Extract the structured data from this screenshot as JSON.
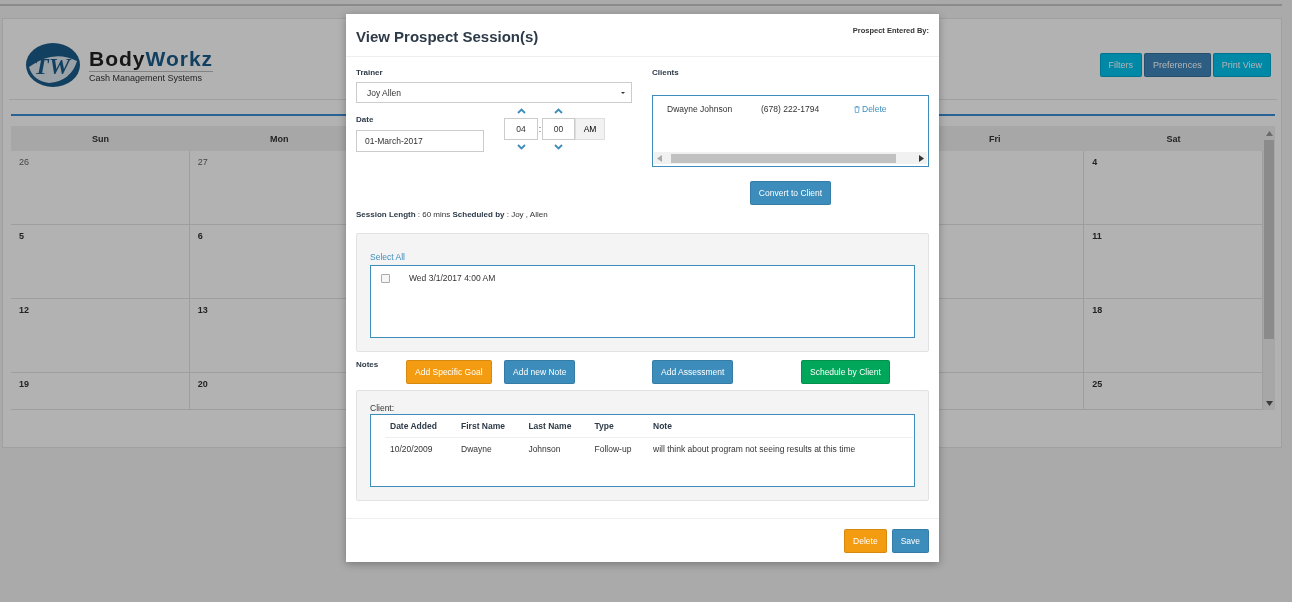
{
  "header": {
    "logo_mark": "TW",
    "brand_dark": "Body",
    "brand_blue": "Workz",
    "tagline": "Cash Management Systems"
  },
  "toolbar": [
    {
      "label": "Filters",
      "kind": "info"
    },
    {
      "label": "Preferences",
      "kind": "primary"
    },
    {
      "label": "Print View",
      "kind": "info"
    }
  ],
  "calendar": {
    "left_columns": [
      {
        "day": "Sun",
        "dates": [
          {
            "label": "26",
            "other_month": true
          },
          {
            "label": "5",
            "other_month": false
          },
          {
            "label": "12",
            "other_month": false
          },
          {
            "label": "19",
            "other_month": false
          }
        ]
      },
      {
        "day": "Mon",
        "dates": [
          {
            "label": "27",
            "other_month": true
          },
          {
            "label": "6",
            "other_month": false
          },
          {
            "label": "13",
            "other_month": false
          },
          {
            "label": "20",
            "other_month": false
          }
        ]
      }
    ],
    "right_columns": [
      {
        "day": "Fri"
      },
      {
        "day": "Sat",
        "dates": [
          {
            "label": "4",
            "other_month": false
          },
          {
            "label": "11",
            "other_month": false
          },
          {
            "label": "18",
            "other_month": false
          },
          {
            "label": "25",
            "other_month": false
          }
        ]
      }
    ]
  },
  "modal": {
    "title": "View Prospect Session(s)",
    "entered_by_label": "Prospect Entered By:",
    "trainer": {
      "label": "Trainer",
      "value": "Joy Allen"
    },
    "date": {
      "label": "Date",
      "value": "01-March-2017",
      "hour": "04",
      "separator": ":",
      "minute": "00",
      "meridiem": "AM"
    },
    "clients": {
      "label": "Clients",
      "rows": [
        {
          "name": "Dwayne Johnson",
          "phone": "(678) 222-1794",
          "action": "Delete"
        }
      ],
      "convert_button": "Convert to Client"
    },
    "session_info": "**Session Length** : 60 mins **Scheduled by** : Joy , Allen",
    "sessions": {
      "select_all": "Select All",
      "items": [
        {
          "label": "Wed 3/1/2017 4:00 AM",
          "checked": false
        }
      ]
    },
    "notes": {
      "label": "Notes",
      "buttons": [
        {
          "label": "Add Specific Goal",
          "kind": "warning"
        },
        {
          "label": "Add new Note",
          "kind": "primary"
        },
        {
          "label": "Add Assessment",
          "kind": "primary"
        },
        {
          "label": "Schedule by Client",
          "kind": "success"
        }
      ],
      "caption": "Client:",
      "columns": [
        "Date Added",
        "First Name",
        "Last Name",
        "Type",
        "Note"
      ],
      "rows": [
        [
          "10/20/2009",
          "Dwayne",
          "Johnson",
          "Follow-up",
          "will think about program not seeing results at this time"
        ]
      ]
    },
    "footer_buttons": [
      {
        "label": "Delete",
        "kind": "warning"
      },
      {
        "label": "Save",
        "kind": "primary"
      }
    ]
  }
}
